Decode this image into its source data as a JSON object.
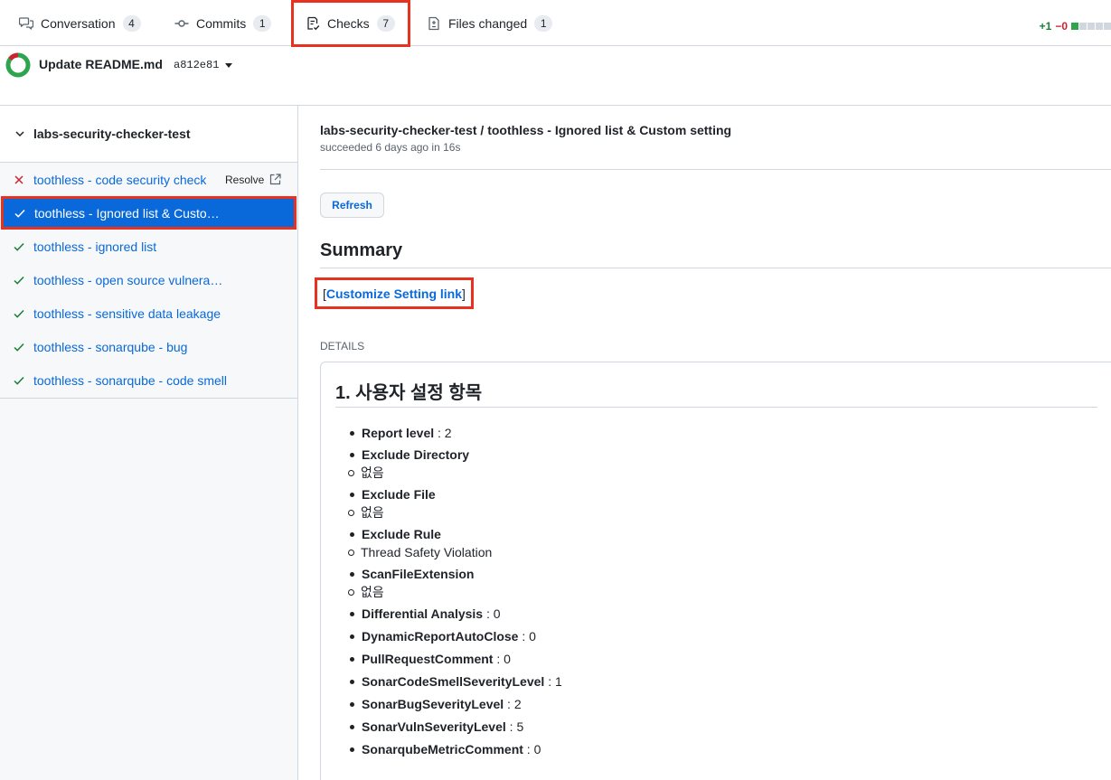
{
  "tabs": [
    {
      "label": "Conversation",
      "count": "4",
      "icon": "comment-discussion-icon"
    },
    {
      "label": "Commits",
      "count": "1",
      "icon": "git-commit-icon"
    },
    {
      "label": "Checks",
      "count": "7",
      "icon": "checklist-icon"
    },
    {
      "label": "Files changed",
      "count": "1",
      "icon": "file-diff-icon"
    }
  ],
  "diffstat": {
    "additions": "+1",
    "deletions": "−0"
  },
  "commit": {
    "title": "Update README.md",
    "sha": "a812e81"
  },
  "sidebar": {
    "suite_name": "labs-security-checker-test",
    "resolve_label": "Resolve",
    "runs": [
      {
        "name": "toothless - code security check",
        "status": "failure"
      },
      {
        "name": "toothless - Ignored list & Custom setting",
        "status": "success"
      },
      {
        "name": "toothless - ignored list",
        "status": "success"
      },
      {
        "name": "toothless - open source vulnerability",
        "status": "success"
      },
      {
        "name": "toothless - sensitive data leakage",
        "status": "success"
      },
      {
        "name": "toothless - sonarqube - bug",
        "status": "success"
      },
      {
        "name": "toothless - sonarqube - code smell",
        "status": "success"
      }
    ]
  },
  "main": {
    "title": "labs-security-checker-test / toothless - Ignored list & Custom setting",
    "subtitle": "succeeded 6 days ago in 16s",
    "refresh_label": "Refresh",
    "summary_heading": "Summary",
    "customize_link": "Customize Setting link",
    "details_label": "DETAILS",
    "details_heading": "1. 사용자 설정 항목",
    "settings": [
      {
        "key": "Report level",
        "value": " : 2"
      },
      {
        "key": "Exclude Directory",
        "sub": "없음"
      },
      {
        "key": "Exclude File",
        "sub": "없음"
      },
      {
        "key": "Exclude Rule",
        "sub": "Thread Safety Violation"
      },
      {
        "key": "ScanFileExtension",
        "sub": "없음"
      },
      {
        "key": "Differential Analysis",
        "value": " : 0"
      },
      {
        "key": "DynamicReportAutoClose",
        "value": " : 0"
      },
      {
        "key": "PullRequestComment",
        "value": " : 0"
      },
      {
        "key": "SonarCodeSmellSeverityLevel",
        "value": " : 1"
      },
      {
        "key": "SonarBugSeverityLevel",
        "value": " : 2"
      },
      {
        "key": "SonarVulnSeverityLevel",
        "value": " : 5"
      },
      {
        "key": "SonarqubeMetricComment",
        "value": " : 0"
      }
    ]
  },
  "colors": {
    "accent": "#0969da",
    "success": "#1a7f37",
    "failure": "#cf222e",
    "highlight": "#e8321f"
  }
}
